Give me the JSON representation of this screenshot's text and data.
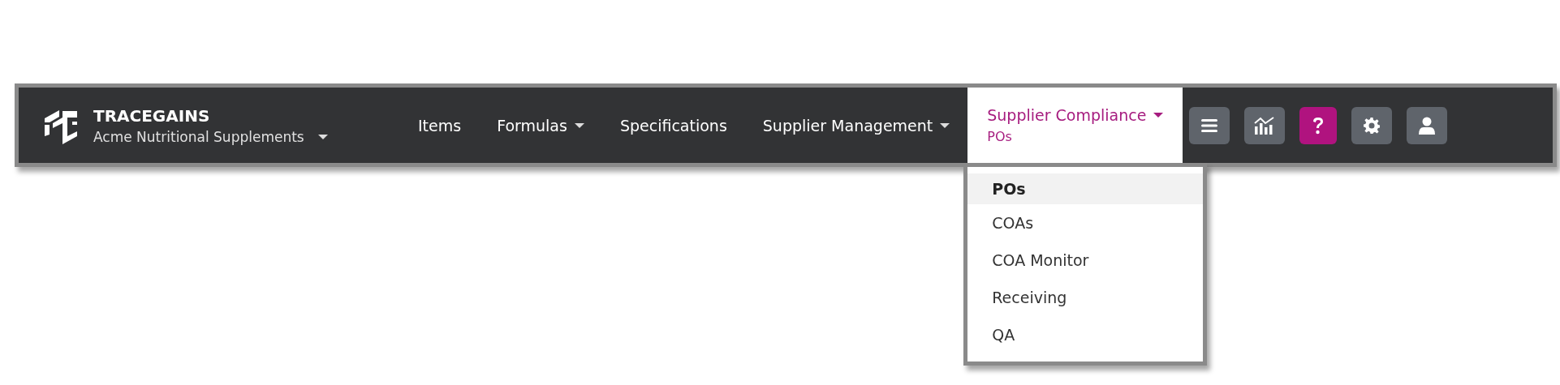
{
  "brand": {
    "name": "TRACEGAINS",
    "organization": "Acme Nutritional Supplements"
  },
  "nav_items": [
    {
      "label": "Items",
      "dropdown": false,
      "selected": false
    },
    {
      "label": "Formulas",
      "dropdown": true,
      "selected": false
    },
    {
      "label": "Specifications",
      "dropdown": false,
      "selected": false
    },
    {
      "label": "Supplier Management",
      "dropdown": true,
      "selected": false
    },
    {
      "label": "Supplier Compliance",
      "dropdown": true,
      "selected": true,
      "subtitle": "POs"
    }
  ],
  "toolbar_buttons": [
    {
      "kind": "menu",
      "highlighted": false
    },
    {
      "kind": "analytics",
      "highlighted": false
    },
    {
      "kind": "help",
      "highlighted": true
    },
    {
      "kind": "settings",
      "highlighted": false
    },
    {
      "kind": "user",
      "highlighted": false
    }
  ],
  "dropdown_menu": [
    {
      "label": "POs",
      "selected": true
    },
    {
      "label": "COAs",
      "selected": false
    },
    {
      "label": "COA Monitor",
      "selected": false
    },
    {
      "label": "Receiving",
      "selected": false
    },
    {
      "label": "QA",
      "selected": false
    }
  ]
}
